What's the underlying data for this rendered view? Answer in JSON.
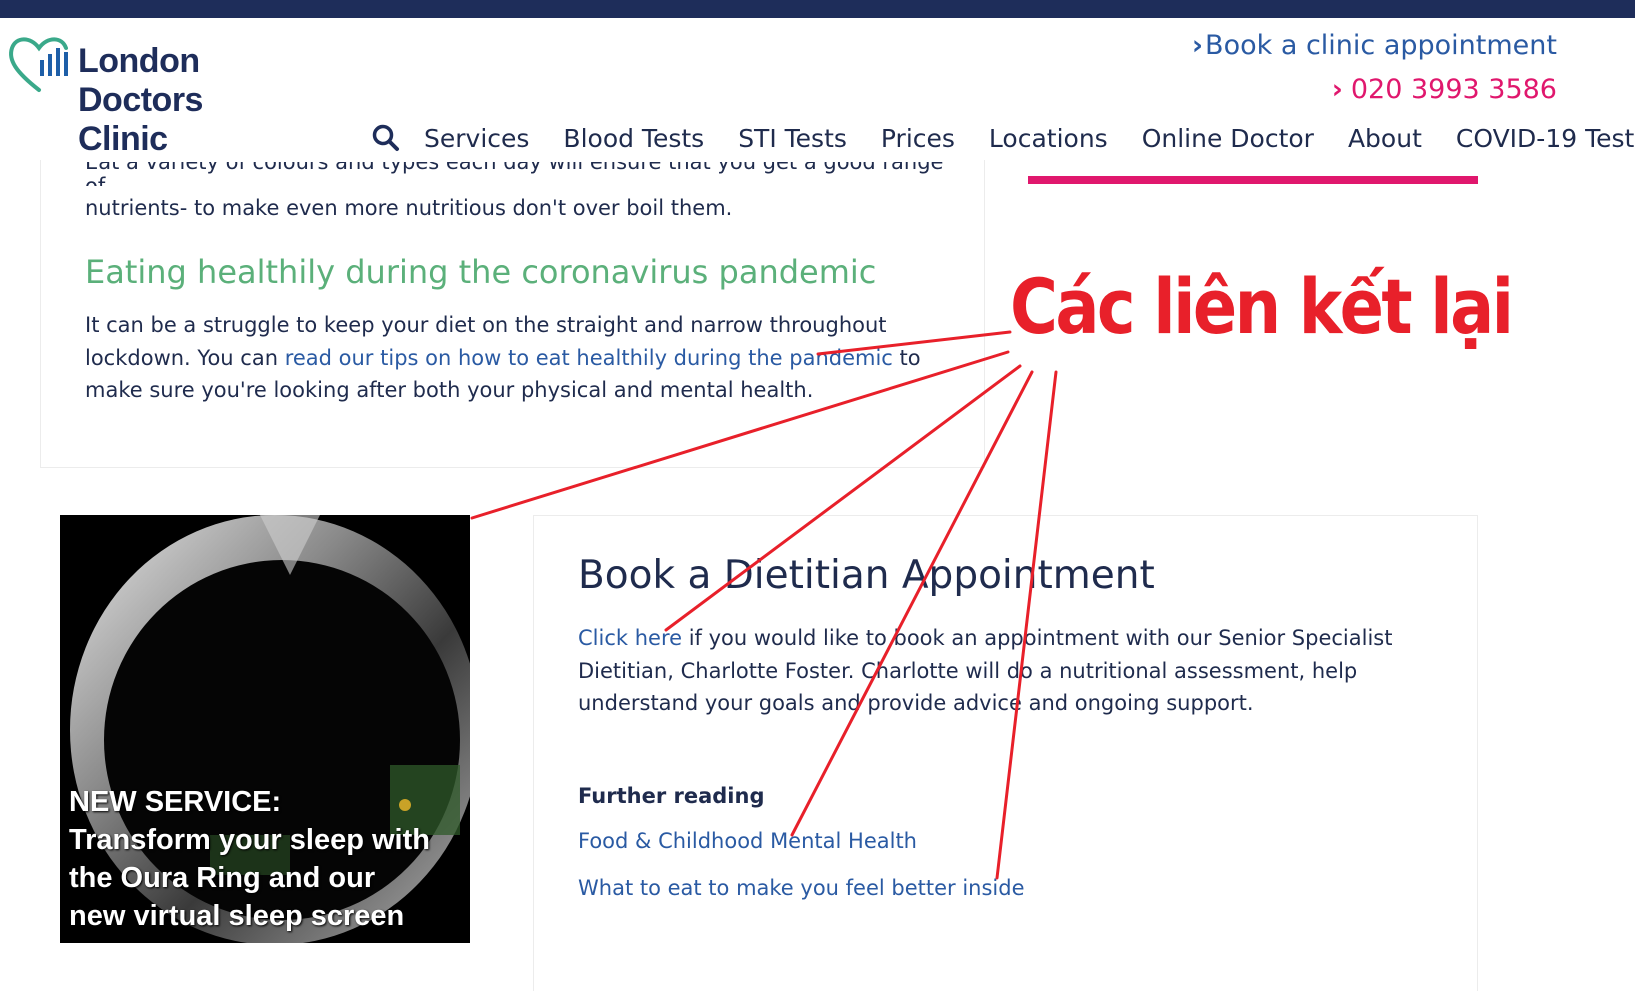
{
  "header": {
    "logo_lines": [
      "London",
      "Doctors",
      "Clinic"
    ],
    "book_link": "Book a clinic appointment",
    "phone": "020 3993 3586",
    "nav": [
      "Services",
      "Blood Tests",
      "STI Tests",
      "Prices",
      "Locations",
      "Online Doctor",
      "About",
      "COVID-19 Test"
    ],
    "search_icon": "search-icon"
  },
  "article": {
    "cut_line": "Eat a variety of colours and types each day will ensure that you get a good range of",
    "p1": "nutrients- to make even more nutritious don't over boil them.",
    "heading": "Eating healthily during the coronavirus pandemic",
    "p2_before": "It can be a struggle to keep your diet on the straight and narrow throughout lockdown. You can ",
    "p2_link": "read our tips on how to eat healthily during the pandemic",
    "p2_after": " to make sure you're looking after both your physical and mental health."
  },
  "promo": {
    "lines": [
      "NEW SERVICE:",
      "Transform your sleep with",
      "the Oura Ring and our",
      "new virtual sleep screen"
    ]
  },
  "book": {
    "title": "Book a Dietitian Appointment",
    "link": "Click here",
    "text": " if you would like to book an appointment with our Senior Specialist Dietitian, Charlotte Foster. Charlotte will do a nutritional assessment, help understand your goals and provide advice and ongoing support.",
    "further_heading": "Further reading",
    "further_links": [
      "Food & Childhood Mental Health",
      "What to eat to make you feel better inside"
    ]
  },
  "annotation": "Các liên kết lại",
  "colors": {
    "navy": "#1e2d5a",
    "pink": "#e0176d",
    "link_blue": "#2a5aa3",
    "green": "#5bb07a",
    "annotation_red": "#e8202a"
  }
}
